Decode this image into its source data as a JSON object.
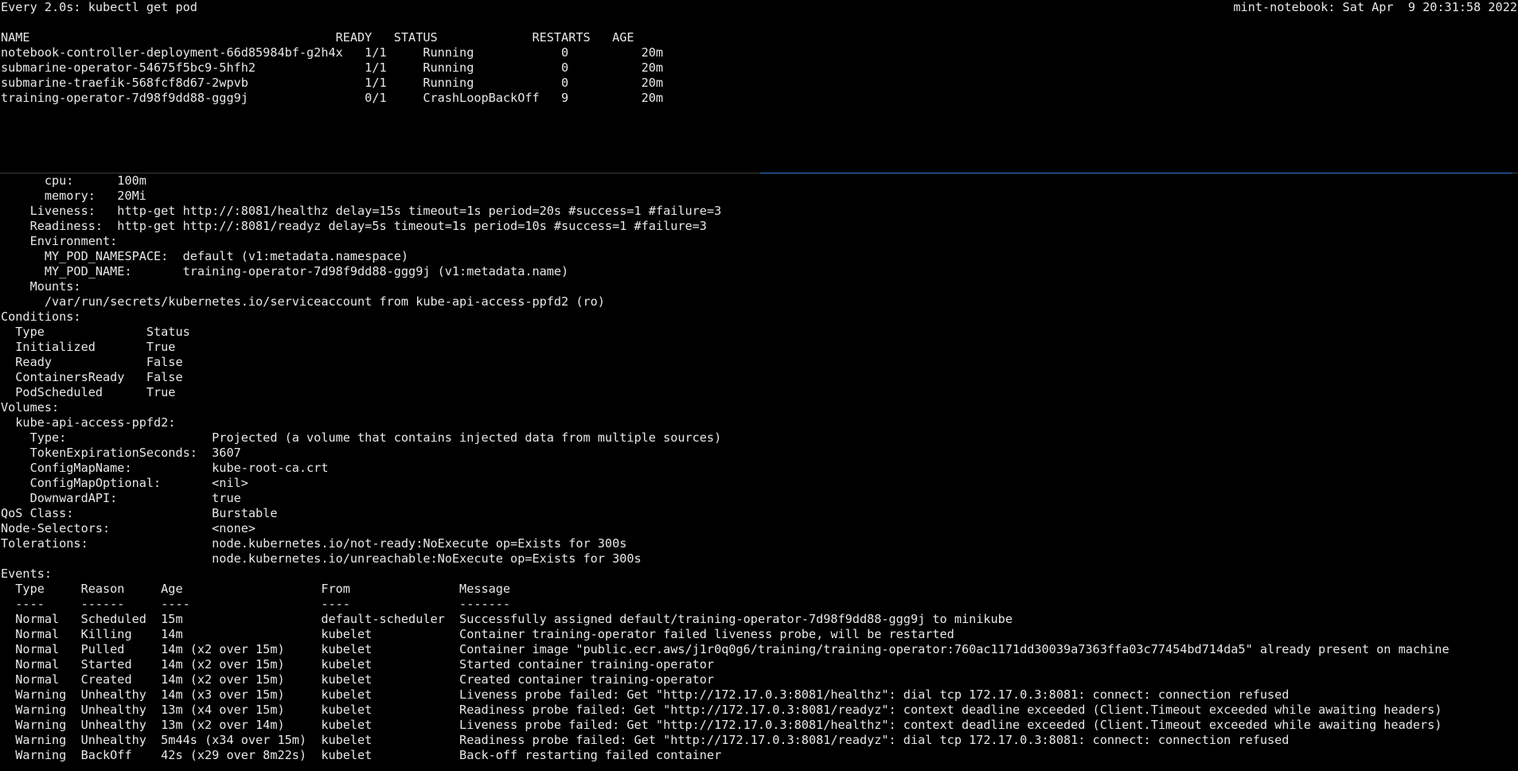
{
  "colors": {
    "background": "#000000",
    "foreground": "#e8e8e8",
    "separator": "#3a3a3a",
    "separator_accent": "#2f7fd6"
  },
  "top_pane": {
    "watch_header": "Every 2.0s: kubectl get pod",
    "host_timestamp": "mint-notebook: Sat Apr  9 20:31:58 2022",
    "lines": [
      "",
      "NAME                                          READY   STATUS             RESTARTS   AGE",
      "notebook-controller-deployment-66d85984bf-g2h4x   1/1     Running            0          20m",
      "submarine-operator-54675f5bc9-5hfh2               1/1     Running            0          20m",
      "submarine-traefik-568fcf8d67-2wpvb                1/1     Running            0          20m",
      "training-operator-7d98f9dd88-ggg9j                0/1     CrashLoopBackOff   9          20m"
    ]
  },
  "bottom_pane": {
    "lines": [
      "      cpu:      100m",
      "      memory:   20Mi",
      "    Liveness:   http-get http://:8081/healthz delay=15s timeout=1s period=20s #success=1 #failure=3",
      "    Readiness:  http-get http://:8081/readyz delay=5s timeout=1s period=10s #success=1 #failure=3",
      "    Environment:",
      "      MY_POD_NAMESPACE:  default (v1:metadata.namespace)",
      "      MY_POD_NAME:       training-operator-7d98f9dd88-ggg9j (v1:metadata.name)",
      "    Mounts:",
      "      /var/run/secrets/kubernetes.io/serviceaccount from kube-api-access-ppfd2 (ro)",
      "Conditions:",
      "  Type              Status",
      "  Initialized       True",
      "  Ready             False",
      "  ContainersReady   False",
      "  PodScheduled      True",
      "Volumes:",
      "  kube-api-access-ppfd2:",
      "    Type:                    Projected (a volume that contains injected data from multiple sources)",
      "    TokenExpirationSeconds:  3607",
      "    ConfigMapName:           kube-root-ca.crt",
      "    ConfigMapOptional:       <nil>",
      "    DownwardAPI:             true",
      "QoS Class:                   Burstable",
      "Node-Selectors:              <none>",
      "Tolerations:                 node.kubernetes.io/not-ready:NoExecute op=Exists for 300s",
      "                             node.kubernetes.io/unreachable:NoExecute op=Exists for 300s",
      "Events:",
      "  Type     Reason     Age                   From               Message",
      "  ----     ------     ----                  ----               -------",
      "  Normal   Scheduled  15m                   default-scheduler  Successfully assigned default/training-operator-7d98f9dd88-ggg9j to minikube",
      "  Normal   Killing    14m                   kubelet            Container training-operator failed liveness probe, will be restarted",
      "  Normal   Pulled     14m (x2 over 15m)     kubelet            Container image \"public.ecr.aws/j1r0q0g6/training/training-operator:760ac1171dd30039a7363ffa03c77454bd714da5\" already present on machine",
      "  Normal   Started    14m (x2 over 15m)     kubelet            Started container training-operator",
      "  Normal   Created    14m (x2 over 15m)     kubelet            Created container training-operator",
      "  Warning  Unhealthy  14m (x3 over 15m)     kubelet            Liveness probe failed: Get \"http://172.17.0.3:8081/healthz\": dial tcp 172.17.0.3:8081: connect: connection refused",
      "  Warning  Unhealthy  13m (x4 over 15m)     kubelet            Readiness probe failed: Get \"http://172.17.0.3:8081/readyz\": context deadline exceeded (Client.Timeout exceeded while awaiting headers)",
      "  Warning  Unhealthy  13m (x2 over 14m)     kubelet            Liveness probe failed: Get \"http://172.17.0.3:8081/healthz\": context deadline exceeded (Client.Timeout exceeded while awaiting headers)",
      "  Warning  Unhealthy  5m44s (x34 over 15m)  kubelet            Readiness probe failed: Get \"http://172.17.0.3:8081/readyz\": dial tcp 172.17.0.3:8081: connect: connection refused",
      "  Warning  BackOff    42s (x29 over 8m22s)  kubelet            Back-off restarting failed container"
    ]
  }
}
